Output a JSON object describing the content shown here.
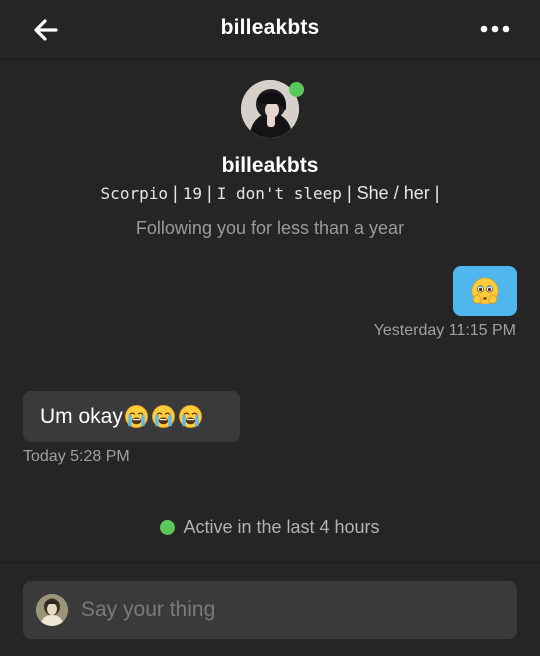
{
  "header": {
    "title": "billeakbts",
    "back_icon": "arrow-left-icon",
    "more_icon": "more-horizontal-icon"
  },
  "profile": {
    "name": "billeakbts",
    "bio_mono_1": "Scorpio",
    "bio_sep": "|",
    "bio_mono_2": "19",
    "bio_mono_3": "I don't sleep",
    "bio_pronoun_1": "She",
    "bio_slash": "/",
    "bio_pronoun_2": "her",
    "follow_status": "Following you for less than a year",
    "online_color": "#5cc85a"
  },
  "messages": [
    {
      "direction": "outgoing",
      "emoji": "face-holding-back-tears",
      "timestamp": "Yesterday 11:15 PM",
      "bubble_color": "#4fb6ee"
    },
    {
      "direction": "incoming",
      "text": "Um okay",
      "emoji": [
        "loudly-crying-face",
        "loudly-crying-face",
        "loudly-crying-face"
      ],
      "timestamp": "Today 5:28 PM",
      "bubble_color": "#3a3a3a"
    }
  ],
  "activity": {
    "text": "Active in the last 4 hours"
  },
  "composer": {
    "placeholder": "Say your thing",
    "value": ""
  }
}
